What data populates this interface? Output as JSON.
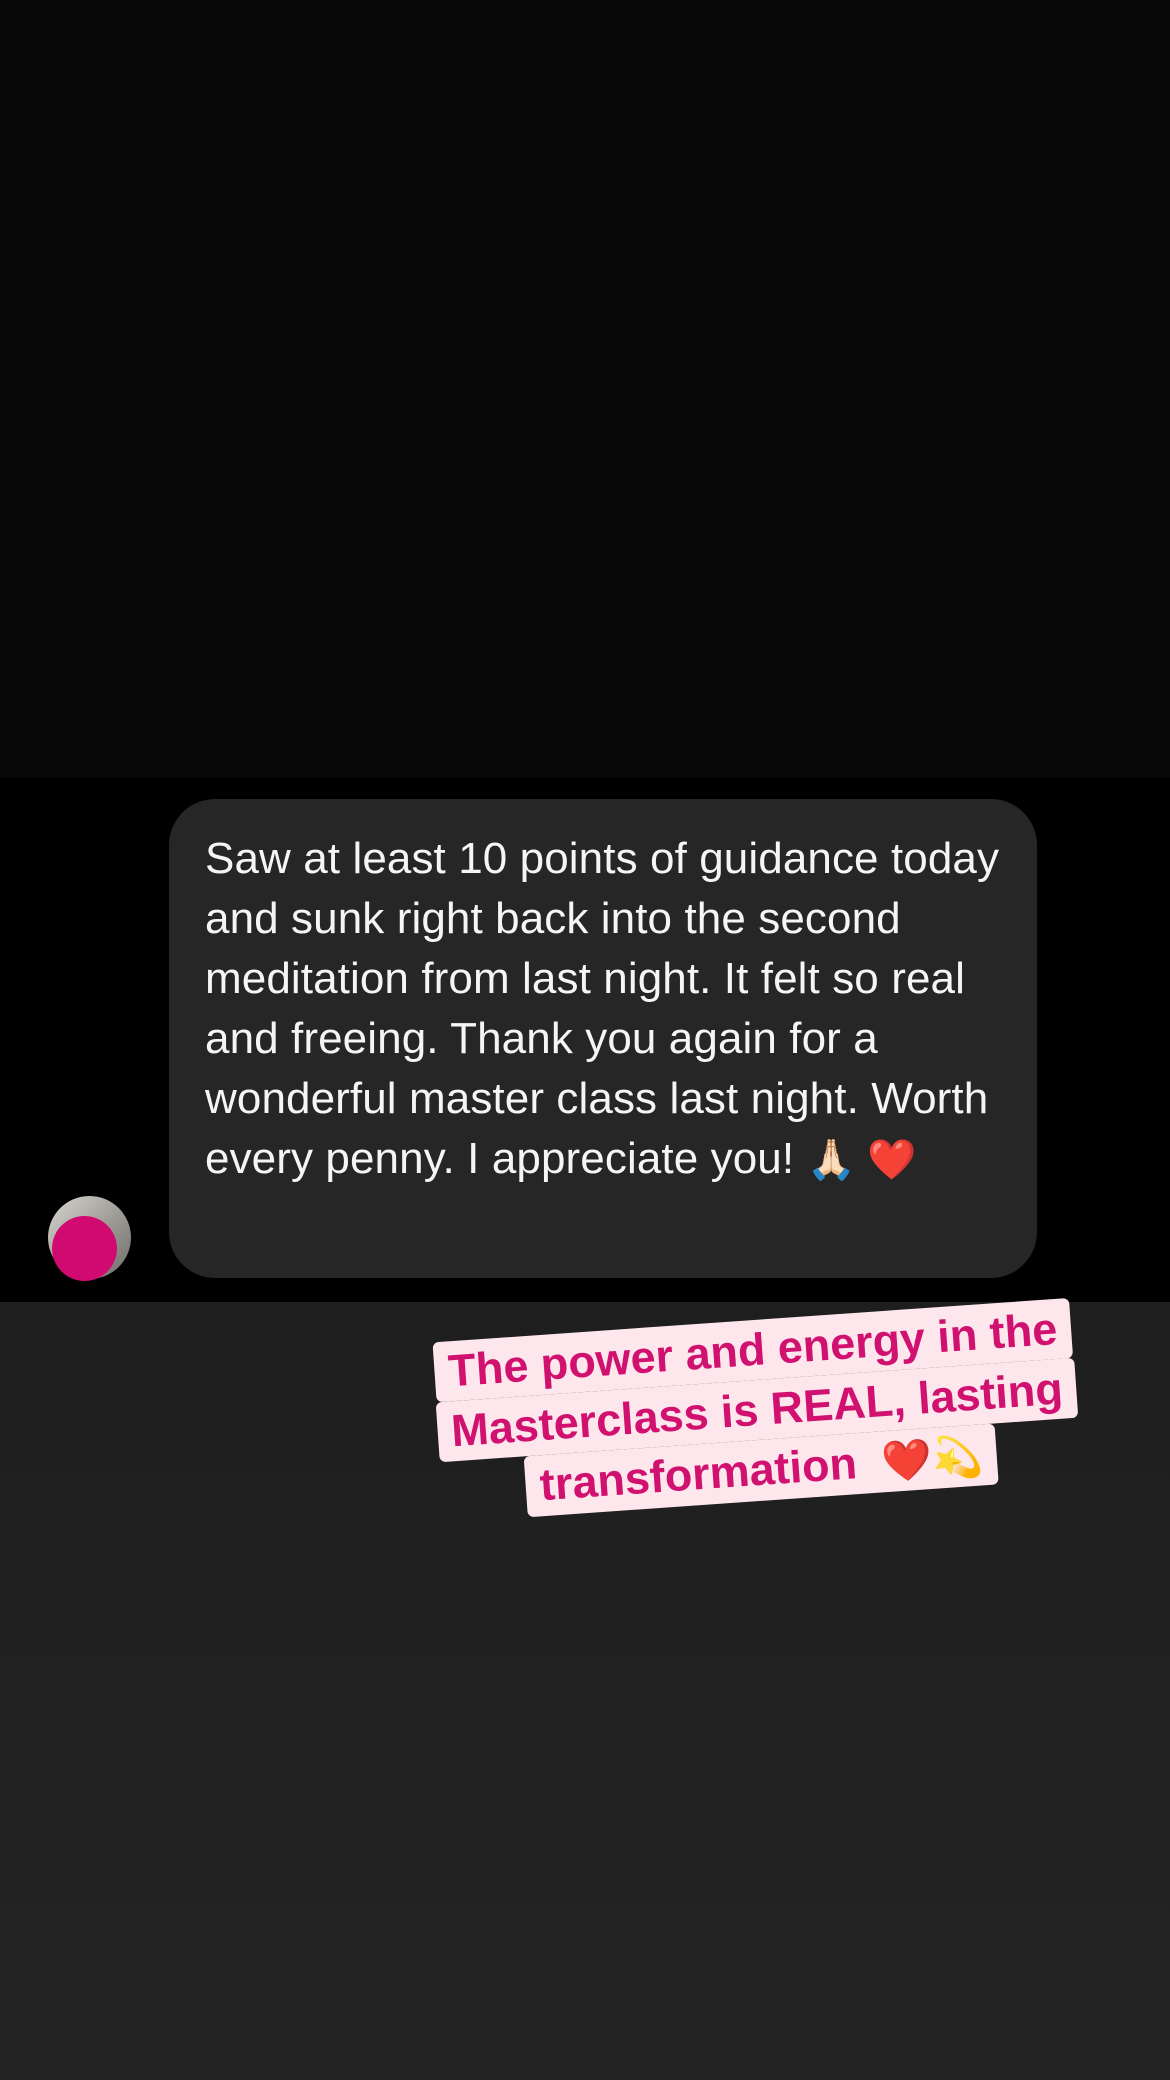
{
  "message": {
    "text": "Saw at least 10 points of guidance today and sunk right back into the second meditation from last night. It felt so real and freeing. Thank you again for a wonderful master class last night. Worth every penny. I appreciate you!",
    "emoji": "🙏🏻 ❤️"
  },
  "caption": {
    "line1": "The power and energy in the",
    "line2": "Masterclass is REAL, lasting",
    "line3": "transformation",
    "emoji": "❤️💫"
  },
  "colors": {
    "background_top": "#070707",
    "message_strip": "#000000",
    "bubble": "#262626",
    "caption_bg": "#fde6ec",
    "caption_text": "#d1116f",
    "avatar_sticker": "#d10a72"
  }
}
